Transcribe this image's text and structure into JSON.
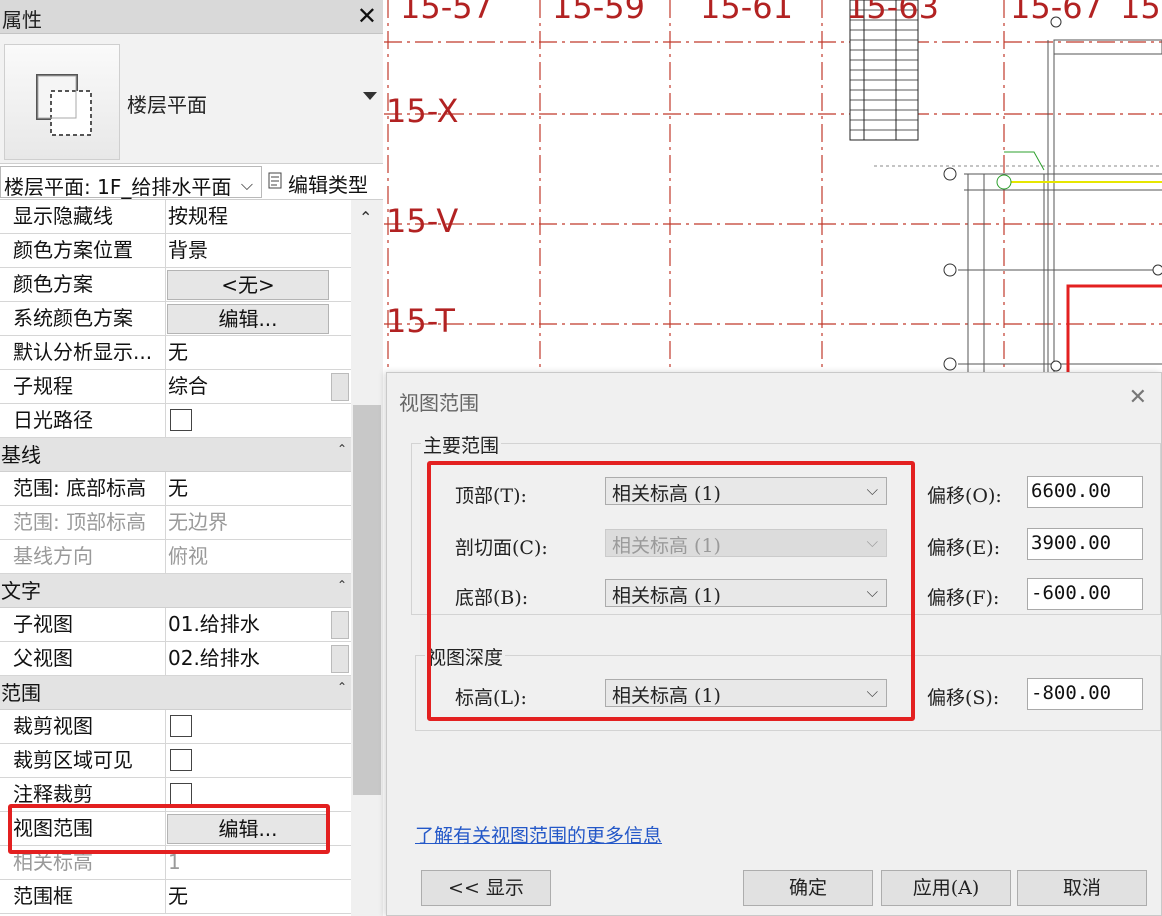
{
  "properties": {
    "title": "属性",
    "close_glyph": "✕",
    "type_name": "楼层平面",
    "instance_filter": "楼层平面: 1F_给排水平面",
    "edit_type_label": "编辑类型",
    "rows": [
      {
        "name": "显示隐藏线",
        "value": "按规程"
      },
      {
        "name": "颜色方案位置",
        "value": "背景"
      },
      {
        "name": "颜色方案",
        "button": "<无>"
      },
      {
        "name": "系统颜色方案",
        "button": "编辑..."
      },
      {
        "name": "默认分析显示...",
        "value": "无"
      },
      {
        "name": "子规程",
        "value": "综合"
      },
      {
        "name": "日光路径",
        "checkbox": false
      }
    ],
    "groups": {
      "underlay": "基线",
      "text": "文字",
      "extents": "范围"
    },
    "underlay_rows": [
      {
        "name": "范围: 底部标高",
        "value": "无"
      },
      {
        "name": "范围: 顶部标高",
        "value": "无边界"
      },
      {
        "name": "基线方向",
        "value": "俯视"
      }
    ],
    "text_rows": [
      {
        "name": "子视图",
        "value": "01.给排水"
      },
      {
        "name": "父视图",
        "value": "02.给排水"
      }
    ],
    "extent_rows": [
      {
        "name": "裁剪视图",
        "checkbox": false
      },
      {
        "name": "裁剪区域可见",
        "checkbox": false
      },
      {
        "name": "注释裁剪",
        "checkbox": false
      },
      {
        "name": "视图范围",
        "button": "编辑..."
      },
      {
        "name": "相关标高",
        "value": "1"
      },
      {
        "name": "范围框",
        "value": "无"
      }
    ]
  },
  "drawing": {
    "grid_labels_top": [
      "15-57",
      "15-59",
      "15-61",
      "15-63",
      "15-67",
      "15-"
    ],
    "grid_labels_left": [
      "15-X",
      "15-V",
      "15-T"
    ]
  },
  "dialog": {
    "title": "视图范围",
    "close_glyph": "✕",
    "primary_range_label": "主要范围",
    "top_label": "顶部(T):",
    "top_value": "相关标高 (1)",
    "top_offset_label": "偏移(O):",
    "top_offset": "6600.00",
    "cut_label": "剖切面(C):",
    "cut_value": "相关标高 (1)",
    "cut_offset_label": "偏移(E):",
    "cut_offset": "3900.00",
    "bottom_label": "底部(B):",
    "bottom_value": "相关标高 (1)",
    "bottom_offset_label": "偏移(F):",
    "bottom_offset": "-600.00",
    "depth_label": "视图深度",
    "level_label": "标高(L):",
    "level_value": "相关标高 (1)",
    "level_offset_label": "偏移(S):",
    "level_offset": "-800.00",
    "learn_more": "了解有关视图范围的更多信息",
    "show_button": "<< 显示",
    "ok_button": "确定",
    "apply_button": "应用(A)",
    "cancel_button": "取消"
  },
  "colors": {
    "highlight": "#e32020",
    "grid_red": "#b22222"
  }
}
